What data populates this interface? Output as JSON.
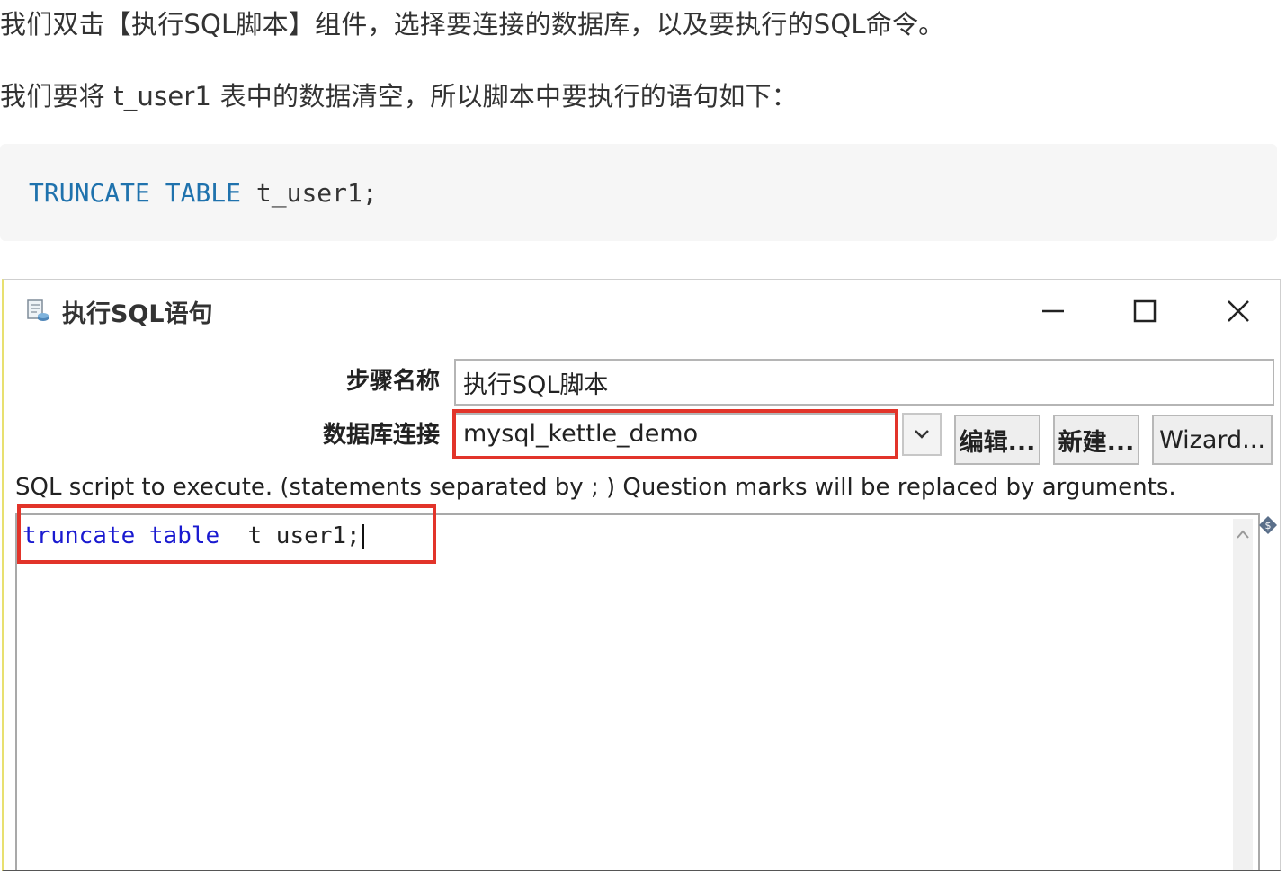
{
  "article": {
    "para1": "我们双击【执行SQL脚本】组件，选择要连接的数据库，以及要执行的SQL命令。",
    "para2": "我们要将 t_user1 表中的数据清空，所以脚本中要执行的语句如下：",
    "code_kw1": "TRUNCATE",
    "code_kw2": "TABLE",
    "code_rest": "t_user1;"
  },
  "dialog": {
    "title": "执行SQL语句",
    "step_name_label": "步骤名称",
    "step_name_value": "执行SQL脚本",
    "db_conn_label": "数据库连接",
    "db_conn_value": "mysql_kettle_demo",
    "edit_button": "编辑...",
    "new_button": "新建...",
    "wizard_button": "Wizard...",
    "hint": "SQL script to execute. (statements separated by ; ) Question marks will be replaced by arguments.",
    "sql_kw1": "truncate",
    "sql_kw2": "table",
    "sql_rest": "t_user1;"
  },
  "icons": {
    "dialog_icon": "sql-script-icon",
    "minimize": "minimize-icon",
    "maximize": "maximize-icon",
    "close": "close-icon",
    "dropdown": "chevron-down-icon",
    "scroll_up": "chevron-up-icon"
  },
  "colors": {
    "highlight_box": "#e2342a",
    "sql_keyword": "#1a1ad0",
    "code_keyword": "#1f72ad"
  }
}
